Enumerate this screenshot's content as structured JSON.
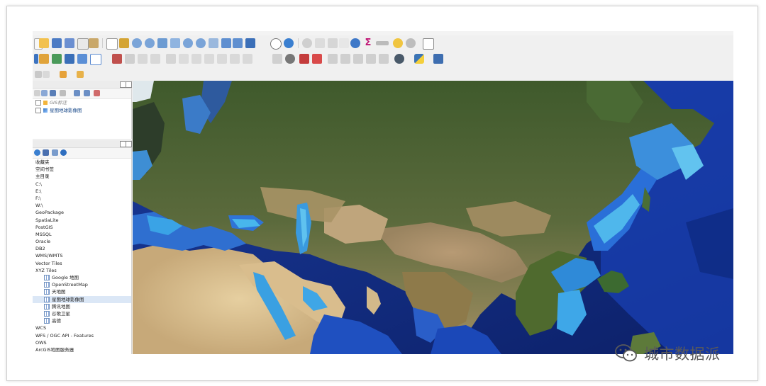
{
  "layers_panel": {
    "items": [
      {
        "label": "GIS标注"
      },
      {
        "label": "星图地球影像图"
      }
    ]
  },
  "browser_panel": {
    "items": [
      {
        "label": "收藏夹",
        "level": 0
      },
      {
        "label": "空间书签",
        "level": 0
      },
      {
        "label": "主目录",
        "level": 0
      },
      {
        "label": "C:\\",
        "level": 0
      },
      {
        "label": "E:\\",
        "level": 0
      },
      {
        "label": "F:\\",
        "level": 0
      },
      {
        "label": "W:\\",
        "level": 0
      },
      {
        "label": "GeoPackage",
        "level": 0
      },
      {
        "label": "SpatiaLite",
        "level": 0
      },
      {
        "label": "PostGIS",
        "level": 0
      },
      {
        "label": "MSSQL",
        "level": 0
      },
      {
        "label": "Oracle",
        "level": 0
      },
      {
        "label": "DB2",
        "level": 0
      },
      {
        "label": "WMS/WMTS",
        "level": 0
      },
      {
        "label": "Vector Tiles",
        "level": 0
      },
      {
        "label": "XYZ Tiles",
        "level": 0
      },
      {
        "label": "Google 地图",
        "level": 1
      },
      {
        "label": "OpenStreetMap",
        "level": 1
      },
      {
        "label": "天地图",
        "level": 1
      },
      {
        "label": "星图地球影像图",
        "level": 1,
        "selected": true
      },
      {
        "label": "腾讯地图",
        "level": 1
      },
      {
        "label": "谷歌卫星",
        "level": 1
      },
      {
        "label": "高德",
        "level": 1
      },
      {
        "label": "WCS",
        "level": 0
      },
      {
        "label": "WFS / OGC API - Features",
        "level": 0
      },
      {
        "label": "OWS",
        "level": 0
      },
      {
        "label": "ArcGIS地图服务器",
        "level": 0
      }
    ]
  },
  "watermark": {
    "text": "城市数据派",
    "icon": "wechat-icon"
  },
  "colors": {
    "ocean_deep": "#102a7a",
    "ocean_shallow": "#3fa0e0",
    "land_green": "#3d5a2a",
    "land_desert": "#d8c29a",
    "selection": "#dbe7f6"
  }
}
